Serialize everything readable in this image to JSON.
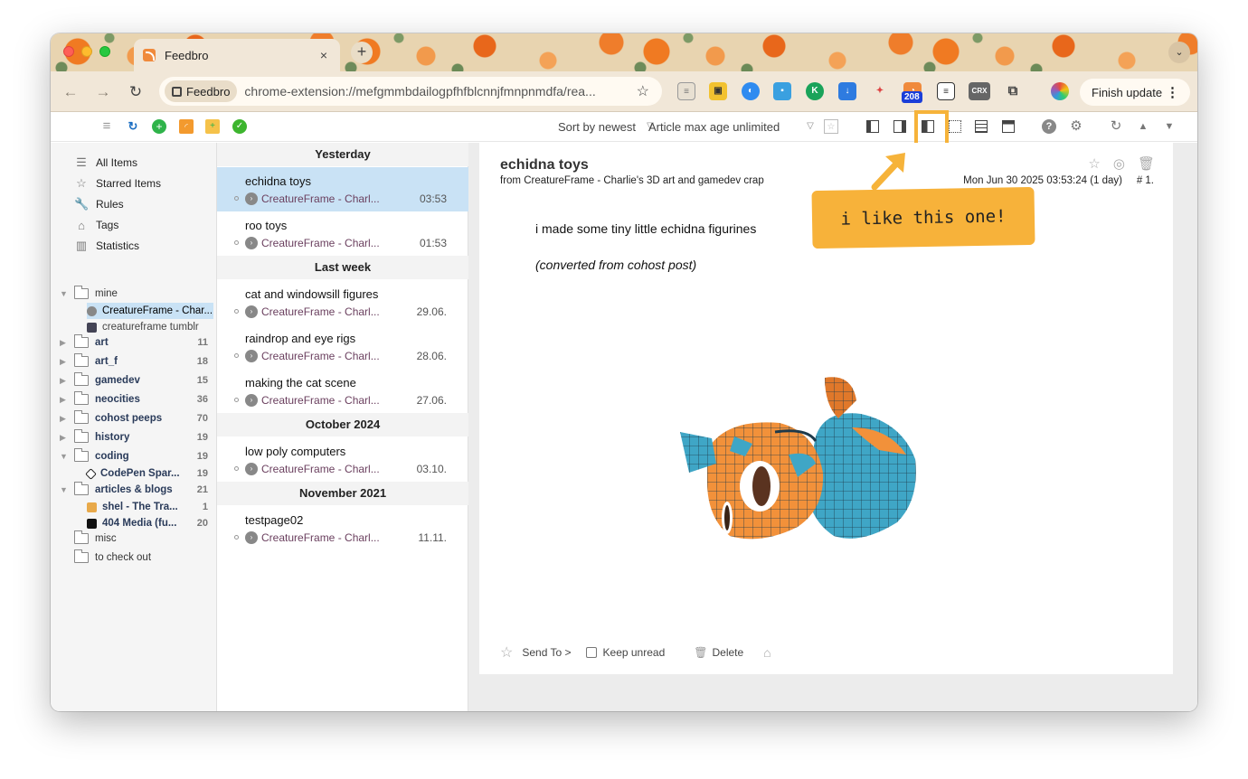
{
  "browser": {
    "tab_title": "Feedbro",
    "tab_close": "×",
    "new_tab": "+",
    "tab_menu": "⌄",
    "chip_label": "Feedbro",
    "url": "chrome-extension://mefgmmbdailogpfhfblcnnjfmnpnmdfa/rea...",
    "ext_badge": "208",
    "ext_crx": "CRX",
    "update_label": "Finish update"
  },
  "toolbar": {
    "sort": "Sort by newest",
    "max_age": "Article max age unlimited"
  },
  "sidebar": {
    "items": [
      {
        "label": "All Items",
        "icon": "list-icon"
      },
      {
        "label": "Starred Items",
        "icon": "star-icon"
      },
      {
        "label": "Rules",
        "icon": "wrench-icon"
      },
      {
        "label": "Tags",
        "icon": "tag-icon"
      },
      {
        "label": "Statistics",
        "icon": "bar-chart-icon"
      }
    ],
    "folders": [
      {
        "name": "mine",
        "count": "",
        "expanded": true,
        "bold": false
      },
      {
        "name": "art",
        "count": "11",
        "bold": true
      },
      {
        "name": "art_f",
        "count": "18",
        "bold": true
      },
      {
        "name": "gamedev",
        "count": "15",
        "bold": true
      },
      {
        "name": "neocities",
        "count": "36",
        "bold": true
      },
      {
        "name": "cohost peeps",
        "count": "70",
        "bold": true
      },
      {
        "name": "history",
        "count": "19",
        "bold": true
      },
      {
        "name": "coding",
        "count": "19",
        "expanded": true,
        "bold": true
      },
      {
        "name": "articles & blogs",
        "count": "21",
        "expanded": true,
        "bold": true
      },
      {
        "name": "misc",
        "count": "",
        "bold": false
      },
      {
        "name": "to check out",
        "count": "",
        "bold": false
      }
    ],
    "feeds": [
      {
        "name": "CreatureFrame - Char...",
        "count": ""
      },
      {
        "name": "creatureframe tumblr",
        "count": ""
      },
      {
        "name": "CodePen Spar...",
        "count": "19"
      },
      {
        "name": "shel - The Tra...",
        "count": "1"
      },
      {
        "name": "404 Media (fu...",
        "count": "20"
      }
    ]
  },
  "articles": {
    "groups": [
      "Yesterday",
      "Last week",
      "October 2024",
      "November 2021"
    ],
    "items": [
      {
        "title": "echidna toys",
        "feed": "CreatureFrame - Charl...",
        "time": "03:53"
      },
      {
        "title": "roo toys",
        "feed": "CreatureFrame - Charl...",
        "time": "01:53"
      },
      {
        "title": "cat and windowsill figures",
        "feed": "CreatureFrame - Charl...",
        "time": "29.06."
      },
      {
        "title": "raindrop and eye rigs",
        "feed": "CreatureFrame - Charl...",
        "time": "28.06."
      },
      {
        "title": "making the cat scene",
        "feed": "CreatureFrame - Charl...",
        "time": "27.06."
      },
      {
        "title": "low poly computers",
        "feed": "CreatureFrame - Charl...",
        "time": "03.10."
      },
      {
        "title": "testpage02",
        "feed": "CreatureFrame - Charl...",
        "time": "11.11."
      }
    ]
  },
  "reader": {
    "title": "echidna toys",
    "from": "from CreatureFrame - Charlie's 3D art and gamedev crap",
    "date": "Mon Jun 30 2025 03:53:24 (1 day)",
    "num": "# 1.",
    "body1": "i made some tiny little echidna figurines",
    "body2": "(converted from cohost post)",
    "send_to": "Send To >",
    "keep_unread": "Keep unread",
    "delete": "Delete"
  },
  "annotation": {
    "note": "i like this one!"
  },
  "colors": {
    "selected_row": "#c9e2f5",
    "highlight": "#f6b33a",
    "feed_text": "#6a3f5e"
  }
}
